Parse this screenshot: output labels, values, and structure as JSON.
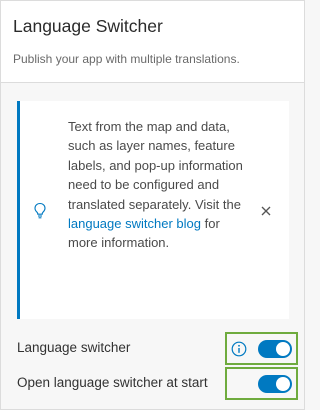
{
  "panel": {
    "title": "Language Switcher",
    "subtitle": "Publish your app with multiple translations."
  },
  "notice": {
    "text_before_link": "Text from the map and data, such as layer names, feature labels, and pop-up information need to be configured and translated separately. Visit the ",
    "link_text": "language switcher blog",
    "text_after_link": " for more information.",
    "icon": "lightbulb-icon",
    "close_icon": "close-icon"
  },
  "settings": [
    {
      "label": "Language switcher",
      "enabled": true,
      "has_info": true
    },
    {
      "label": "Open language switcher at start",
      "enabled": true,
      "has_info": false
    }
  ],
  "colors": {
    "accent": "#0079c1",
    "highlight": "#6fab3e"
  }
}
